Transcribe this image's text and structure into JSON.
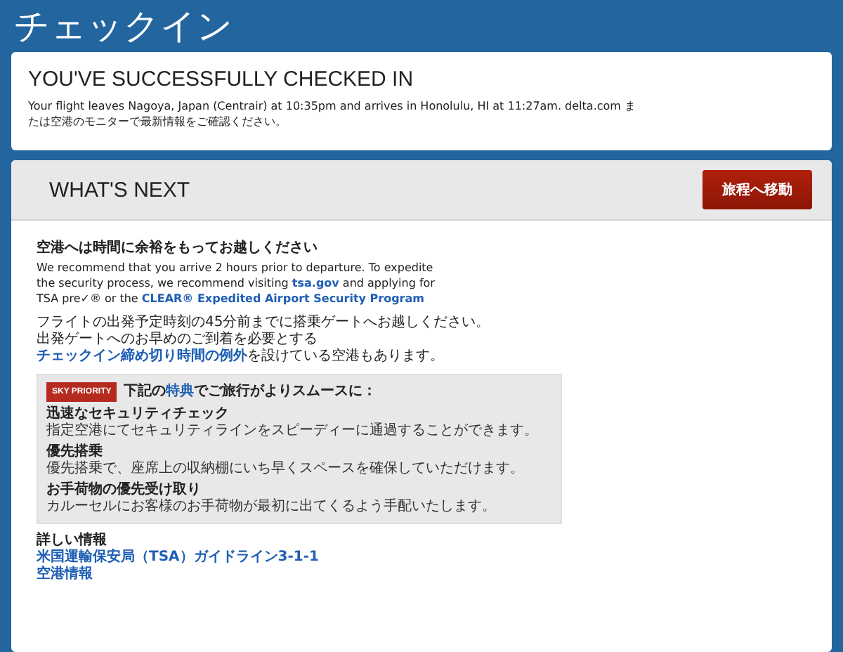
{
  "page_title": "チェックイン",
  "confirmation": {
    "heading": "YOU'VE SUCCESSFULLY CHECKED IN",
    "message": "Your flight leaves Nagoya, Japan (Centrair) at 10:35pm and arrives in Honolulu, HI at 11:27am.  delta.com または空港のモニターで最新情報をご確認ください。"
  },
  "next": {
    "heading": "WHAT'S NEXT",
    "button": "旅程へ移動",
    "airport_heading": "空港へは時間に余裕をもってお越しください",
    "paragraphs": [
      {
        "parts": [
          {
            "kind": "text",
            "text": "We recommend that you arrive 2 hours prior to departure. To expedite the security process, we recommend visiting "
          },
          {
            "kind": "link",
            "text": "tsa.gov"
          },
          {
            "kind": "text",
            "text": " and applying for TSA pre✓® or the "
          },
          {
            "kind": "link",
            "text": "CLEAR® Expedited Airport Security Program"
          }
        ]
      },
      {
        "parts": [
          {
            "kind": "text",
            "text": "フライトの出発予定時刻の45分前までに搭乗ゲートへお越しください。出発ゲートへのお早めのご到着を必要とする"
          },
          {
            "kind": "link",
            "text": "チェックイン締め切り時間の例外"
          },
          {
            "kind": "text",
            "text": "を設けている空港もあります。"
          }
        ]
      }
    ],
    "priority": {
      "logo": "SKY PRIORITY",
      "intro": [
        {
          "kind": "text",
          "text": "下記の"
        },
        {
          "kind": "link",
          "text": "特典"
        },
        {
          "kind": "text",
          "text": "でご旅行がよりスムースに："
        }
      ],
      "benefits": [
        {
          "title": "迅速なセキュリティチェック",
          "text": "指定空港にてセキュリティラインをスピーディーに通過することができます。"
        },
        {
          "title": "優先搭乗",
          "text": "優先搭乗で、座席上の収納棚にいち早くスペースを確保していただけます。"
        },
        {
          "title": "お手荷物の優先受け取り",
          "text": "カルーセルにお客様のお手荷物が最初に出てくるよう手配いたします。"
        }
      ]
    },
    "more_heading": "詳しい情報",
    "links": [
      "米国運輸保安局（TSA）ガイドライン3-1-1",
      "空港情報"
    ]
  }
}
